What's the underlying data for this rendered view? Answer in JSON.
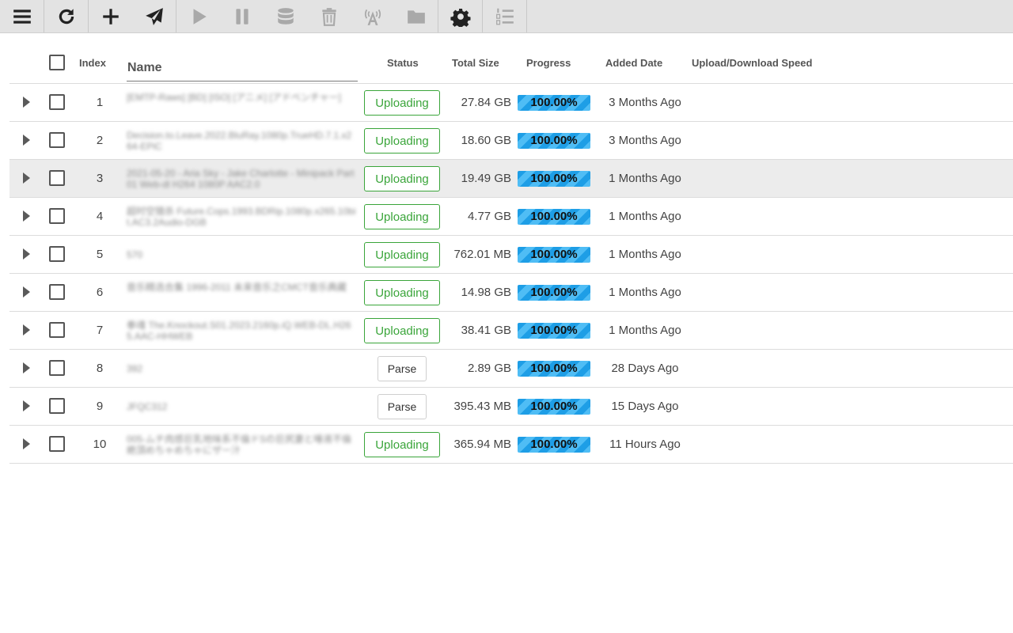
{
  "toolbar": {
    "groups": [
      [
        {
          "icon": "menu-icon",
          "enabled": true
        }
      ],
      [
        {
          "icon": "refresh-icon",
          "enabled": true
        }
      ],
      [
        {
          "icon": "add-icon",
          "enabled": true
        },
        {
          "icon": "send-icon",
          "enabled": true
        }
      ],
      [
        {
          "icon": "play-icon",
          "enabled": false
        },
        {
          "icon": "pause-icon",
          "enabled": false
        },
        {
          "icon": "database-icon",
          "enabled": false
        },
        {
          "icon": "trash-icon",
          "enabled": false
        },
        {
          "icon": "broadcast-icon",
          "enabled": false
        },
        {
          "icon": "folder-icon",
          "enabled": false
        }
      ],
      [
        {
          "icon": "gear-icon",
          "enabled": true
        }
      ],
      [
        {
          "icon": "ordered-list-icon",
          "enabled": false
        }
      ]
    ]
  },
  "table": {
    "headers": {
      "index": "Index",
      "name": "Name",
      "status": "Status",
      "total_size": "Total Size",
      "progress": "Progress",
      "added_date": "Added Date",
      "speed": "Upload/Download Speed"
    },
    "rows": [
      {
        "index": "1",
        "name": "[EMTP-Raws] [BD] [ISO] [アニメ] [アドベンチャー]",
        "status": "Uploading",
        "status_type": "upload",
        "size": "27.84 GB",
        "progress": "100.00%",
        "progress_value": 1.0,
        "date": "3 Months Ago",
        "highlight": false
      },
      {
        "index": "2",
        "name": "Decision.to.Leave.2022.BluRay.1080p.TrueHD.7.1.x264-EPiC",
        "status": "Uploading",
        "status_type": "upload",
        "size": "18.60 GB",
        "progress": "100.00%",
        "progress_value": 1.0,
        "date": "3 Months Ago",
        "highlight": false
      },
      {
        "index": "3",
        "name": "2021-05-20 - Aria Sky - Jake Charlotte - Minipack Part01 Web-dl H264 1080P AAC2.0",
        "status": "Uploading",
        "status_type": "upload",
        "size": "19.49 GB",
        "progress": "100.00%",
        "progress_value": 1.0,
        "date": "1 Months Ago",
        "highlight": true
      },
      {
        "index": "4",
        "name": "超时空猎杀 Future.Cops.1993.BDRip.1080p.x265.10bit.AC3.2Audio-DGB",
        "status": "Uploading",
        "status_type": "upload",
        "size": "4.77 GB",
        "progress": "100.00%",
        "progress_value": 1.0,
        "date": "1 Months Ago",
        "highlight": false
      },
      {
        "index": "5",
        "name": "570",
        "status": "Uploading",
        "status_type": "upload",
        "size": "762.01 MB",
        "progress": "100.00%",
        "progress_value": 1.0,
        "date": "1 Months Ago",
        "highlight": false
      },
      {
        "index": "6",
        "name": "音乐精选合集 1996-2011 未来音乐之CMCT音乐典藏",
        "status": "Uploading",
        "status_type": "upload",
        "size": "14.98 GB",
        "progress": "100.00%",
        "progress_value": 1.0,
        "date": "1 Months Ago",
        "highlight": false
      },
      {
        "index": "7",
        "name": "拳魂 The.Knockout.S01.2023.2160p.iQ.WEB-DL.H265.AAC-HHWEB",
        "status": "Uploading",
        "status_type": "upload",
        "size": "38.41 GB",
        "progress": "100.00%",
        "progress_value": 1.0,
        "date": "1 Months Ago",
        "highlight": false
      },
      {
        "index": "8",
        "name": "392",
        "status": "Parse",
        "status_type": "parse",
        "size": "2.89 GB",
        "progress": "100.00%",
        "progress_value": 1.0,
        "date": "28 Days Ago",
        "highlight": false
      },
      {
        "index": "9",
        "name": "JFQC312",
        "status": "Parse",
        "status_type": "parse",
        "size": "395.43 MB",
        "progress": "100.00%",
        "progress_value": 1.0,
        "date": "15 Days Ago",
        "highlight": false
      },
      {
        "index": "10",
        "name": "005-ムチ肉感巨乳地味系不倫ドSの巨尻妻と唾液不倫絶頂めちゃめちゃにザー汁",
        "status": "Uploading",
        "status_type": "upload",
        "size": "365.94 MB",
        "progress": "100.00%",
        "progress_value": 1.0,
        "date": "11 Hours Ago",
        "highlight": false
      }
    ]
  }
}
